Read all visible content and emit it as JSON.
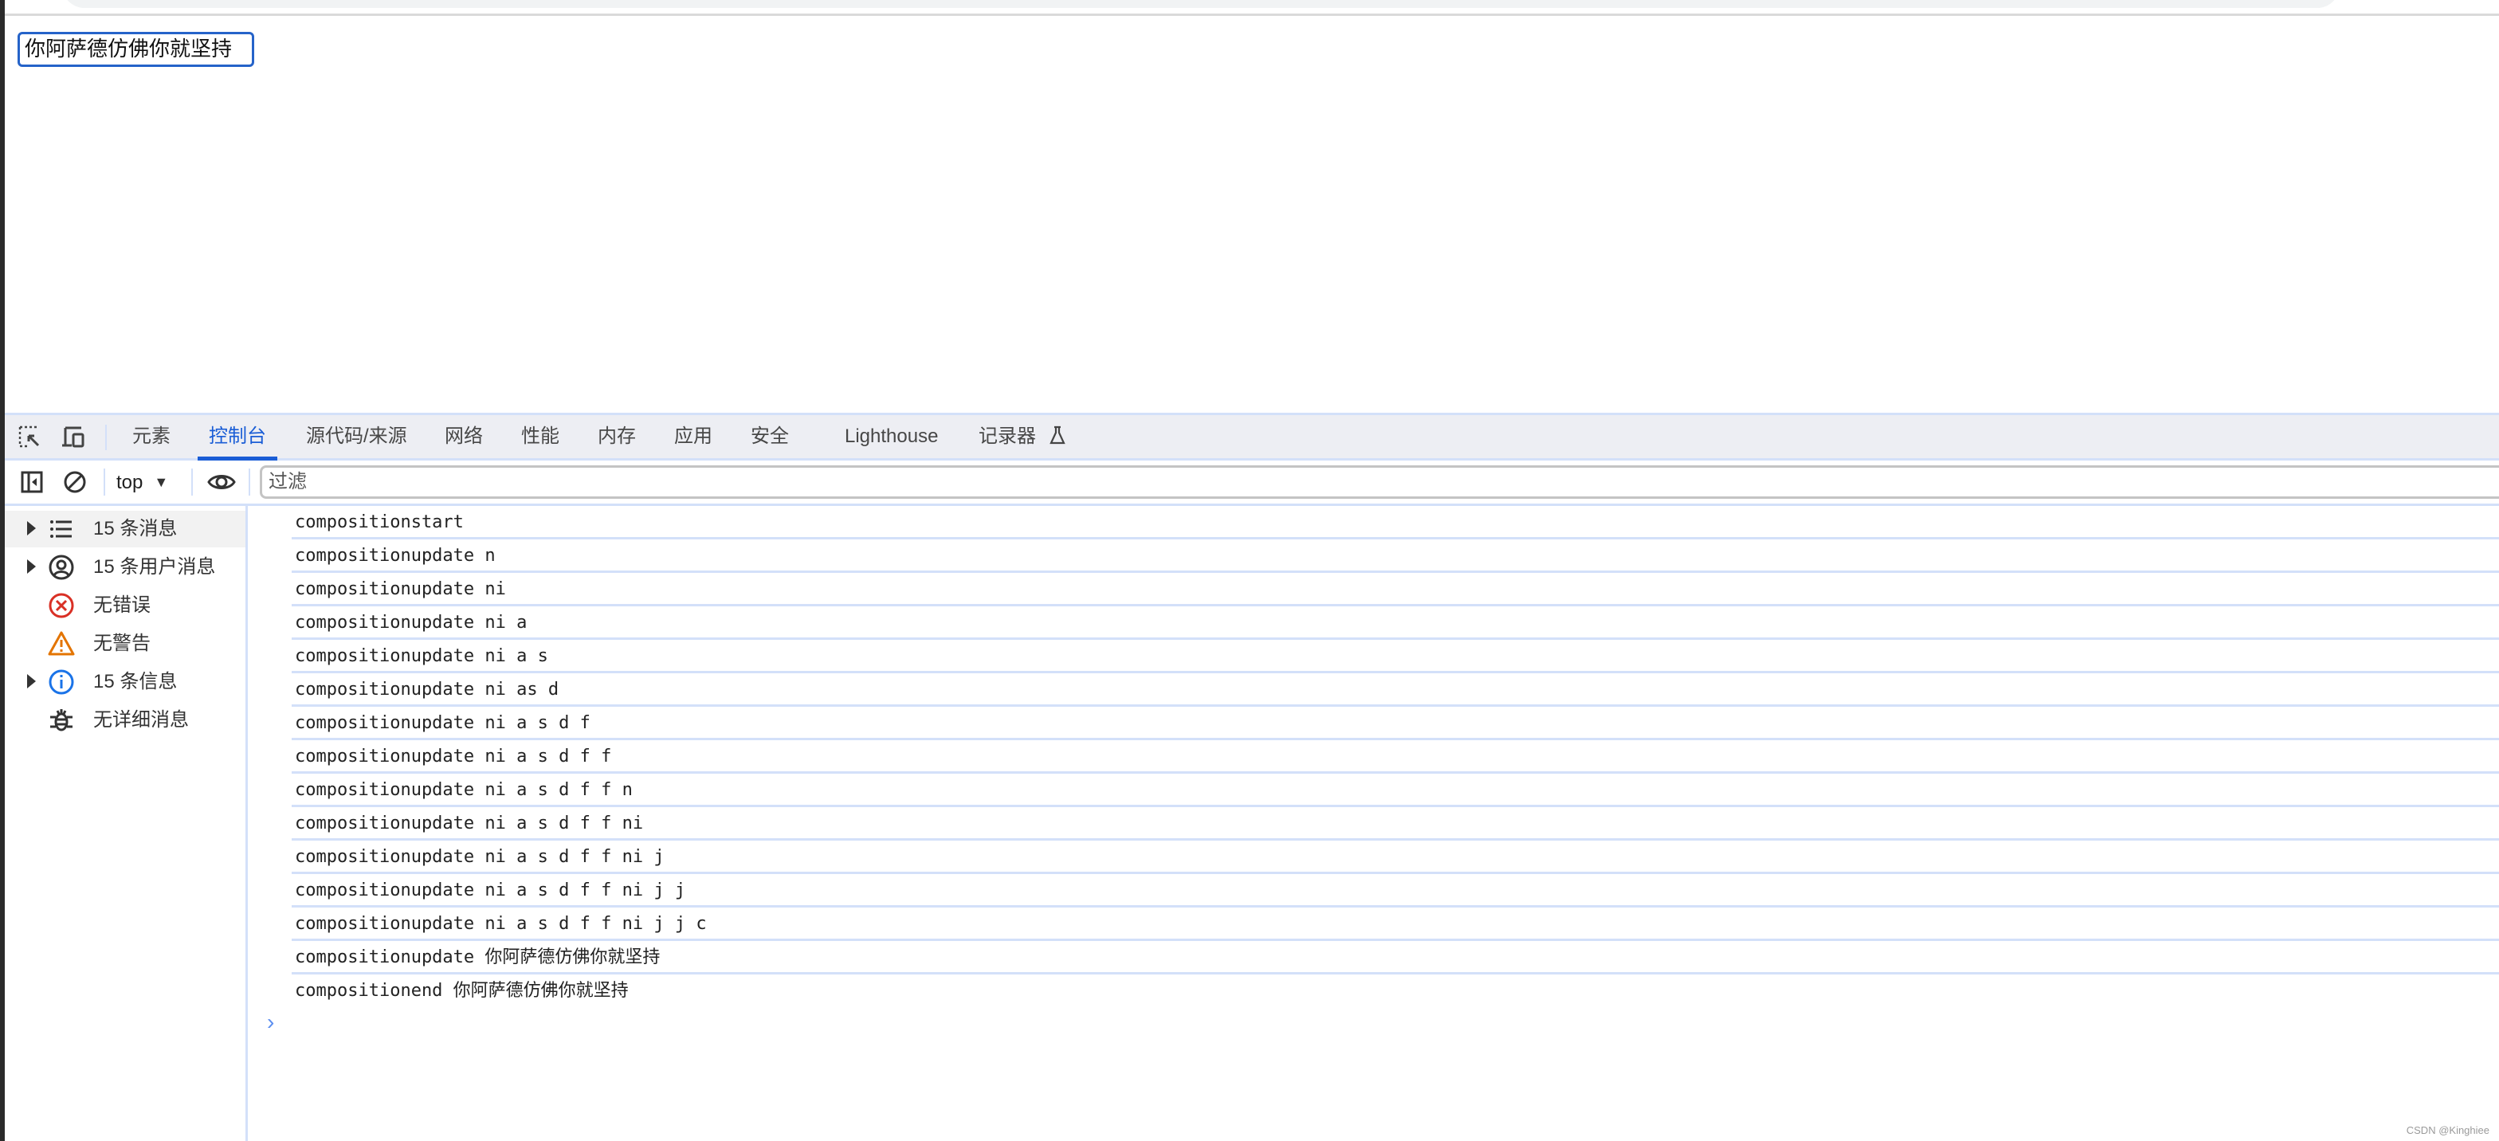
{
  "page": {
    "input_value": "你阿萨德仿佛你就坚持"
  },
  "devtools": {
    "tabs": [
      {
        "label": "元素",
        "active": false
      },
      {
        "label": "控制台",
        "active": true
      },
      {
        "label": "源代码/来源",
        "active": false
      },
      {
        "label": "网络",
        "active": false
      },
      {
        "label": "性能",
        "active": false
      },
      {
        "label": "内存",
        "active": false
      },
      {
        "label": "应用",
        "active": false
      },
      {
        "label": "安全",
        "active": false
      },
      {
        "label": "Lighthouse",
        "active": false
      },
      {
        "label": "记录器",
        "active": false
      }
    ],
    "toolbar": {
      "context": "top",
      "filter_placeholder": "过滤"
    },
    "sidebar": {
      "items": [
        {
          "label": "15 条消息",
          "icon": "list-icon",
          "expandable": true,
          "selected": true
        },
        {
          "label": "15 条用户消息",
          "icon": "user-icon",
          "expandable": true,
          "selected": false
        },
        {
          "label": "无错误",
          "icon": "error-icon",
          "expandable": false,
          "selected": false
        },
        {
          "label": "无警告",
          "icon": "warning-icon",
          "expandable": false,
          "selected": false
        },
        {
          "label": "15 条信息",
          "icon": "info-icon",
          "expandable": true,
          "selected": false
        },
        {
          "label": "无详细消息",
          "icon": "bug-icon",
          "expandable": false,
          "selected": false
        }
      ]
    },
    "messages": [
      "compositionstart",
      "compositionupdate n",
      "compositionupdate ni",
      "compositionupdate ni a",
      "compositionupdate ni a s",
      "compositionupdate ni as d",
      "compositionupdate ni a s d f",
      "compositionupdate ni a s d f f",
      "compositionupdate ni a s d f f n",
      "compositionupdate ni a s d f f ni",
      "compositionupdate ni a s d f f ni j",
      "compositionupdate ni a s d f f ni j j",
      "compositionupdate ni a s d f f ni j j c",
      "compositionupdate 你阿萨德仿佛你就坚持",
      "compositionend 你阿萨德仿佛你就坚持"
    ],
    "prompt_glyph": "›"
  },
  "colors": {
    "accent": "#1a5dd6",
    "error": "#d93025",
    "warning": "#e37400",
    "info": "#1a73e8"
  },
  "watermark": "CSDN @Kinghiee"
}
